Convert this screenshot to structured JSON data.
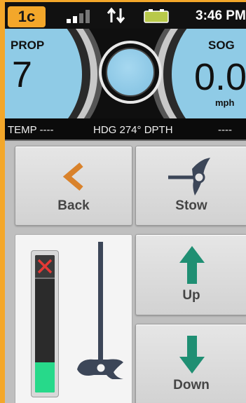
{
  "status_bar": {
    "channel": "1c",
    "signal_bars": 4,
    "signal_bars_active": 2,
    "time": "3:46 PM",
    "icons": [
      "signal-bars-icon",
      "data-transfer-icon",
      "battery-icon"
    ]
  },
  "gauges": {
    "prop": {
      "label": "PROP",
      "value": "7"
    },
    "sog": {
      "label": "SOG",
      "value": "0.0",
      "unit": "mph"
    }
  },
  "info_strip": {
    "temp": "TEMP ----",
    "heading": "HDG 274°  DPTH",
    "depth_value": "----"
  },
  "buttons": {
    "back": {
      "label": "Back",
      "icon": "chevron-left-icon"
    },
    "stow": {
      "label": "Stow",
      "icon": "stow-motor-icon"
    },
    "up": {
      "label": "Up",
      "icon": "arrow-up-icon"
    },
    "down": {
      "label": "Down",
      "icon": "arrow-down-icon"
    }
  },
  "position_panel": {
    "depth_level_fraction": 0.22,
    "limit_icon": "stop-x-icon",
    "motor_icon": "trolling-motor-icon"
  },
  "colors": {
    "accent": "#f3a72a",
    "gauge_blue": "#8fcbe6",
    "back_chevron": "#d9822b",
    "arrow_teal": "#1f8f73",
    "depth_fill": "#27d98a",
    "stop_red": "#e53935",
    "icon_slate": "#3c4658"
  }
}
